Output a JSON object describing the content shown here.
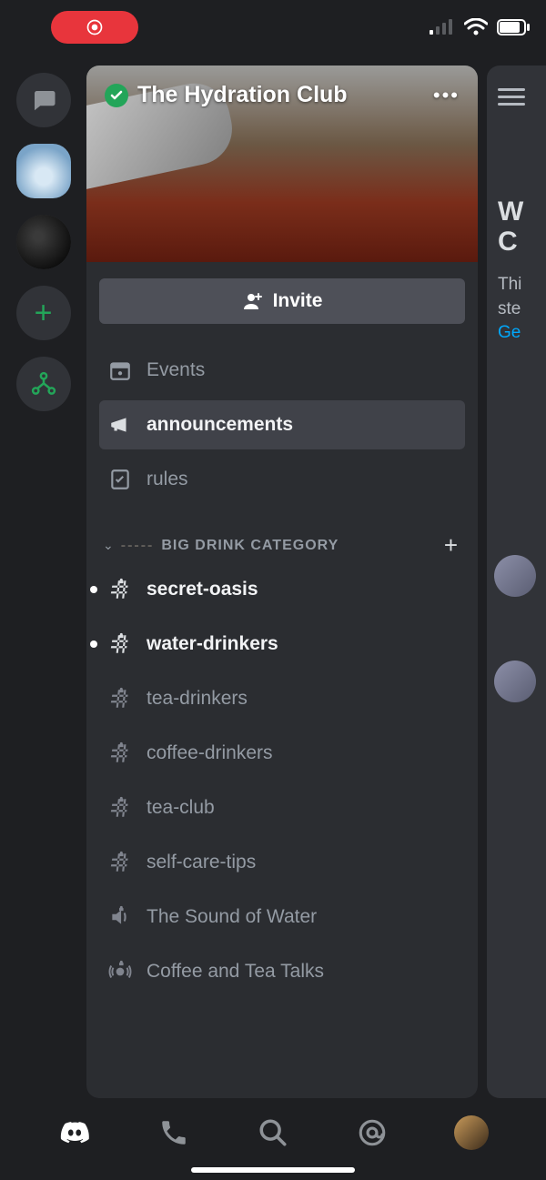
{
  "status": {
    "recording": true
  },
  "server": {
    "name": "The Hydration Club",
    "invite_label": "Invite",
    "events_label": "Events",
    "announcements_label": "announcements",
    "rules_label": "rules"
  },
  "category": {
    "name": "BIG DRINK CATEGORY"
  },
  "channels": [
    {
      "name": "secret-oasis",
      "type": "text-locked",
      "unread": true,
      "bright": true
    },
    {
      "name": "water-drinkers",
      "type": "text-locked",
      "unread": true,
      "bright": true
    },
    {
      "name": "tea-drinkers",
      "type": "text-locked",
      "unread": false,
      "bright": false
    },
    {
      "name": "coffee-drinkers",
      "type": "text-locked",
      "unread": false,
      "bright": false
    },
    {
      "name": "tea-club",
      "type": "text-locked",
      "unread": false,
      "bright": false
    },
    {
      "name": "self-care-tips",
      "type": "text-locked",
      "unread": false,
      "bright": false
    },
    {
      "name": "The Sound of Water",
      "type": "voice-locked",
      "unread": false,
      "bright": false
    },
    {
      "name": "Coffee and Tea Talks",
      "type": "stage-locked",
      "unread": false,
      "bright": false
    }
  ],
  "sliver": {
    "heading_line1": "W",
    "heading_line2": "C",
    "body_line1": "Thi",
    "body_line2": "ste",
    "link": "Ge"
  },
  "icons": {
    "dm": "dm-icon",
    "add_server": "add-server-icon",
    "hub": "discover-hub-icon",
    "events": "calendar-icon",
    "announcements": "megaphone-icon",
    "rules": "rules-icon",
    "hash_lock": "hash-lock-icon",
    "voice_lock": "speaker-lock-icon",
    "stage_lock": "stage-lock-icon",
    "discord": "discord-logo-icon",
    "friends": "friends-icon",
    "search": "search-icon",
    "mentions": "at-icon"
  }
}
